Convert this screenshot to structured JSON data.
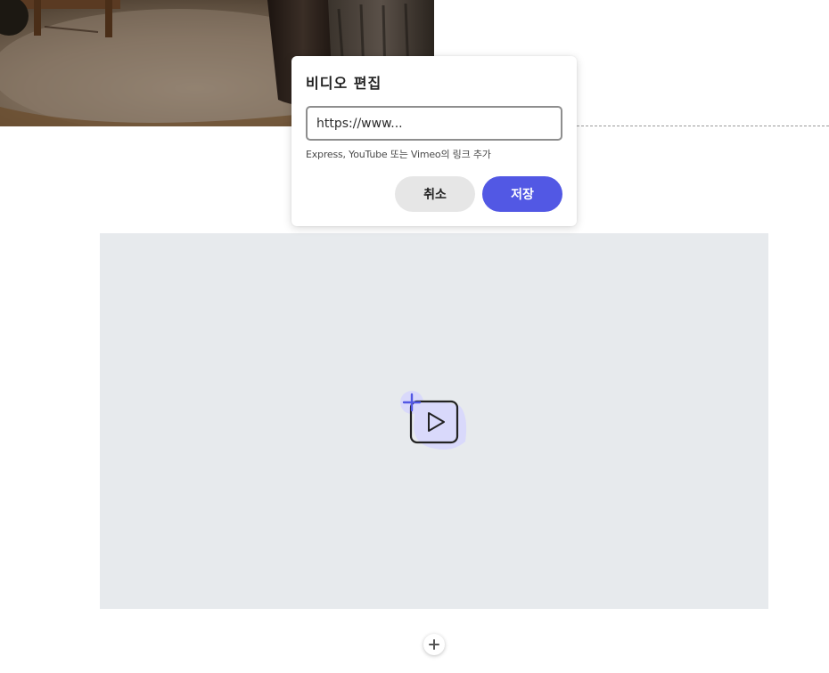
{
  "dialog": {
    "title": "비디오 편집",
    "url_placeholder": "https://www...",
    "helper_text": "Express, YouTube 또는 Vimeo의 링크 추가",
    "cancel_label": "취소",
    "save_label": "저장"
  },
  "icons": {
    "video_add": "video-add-icon",
    "add_block": "plus-icon"
  },
  "colors": {
    "accent": "#5258e4",
    "placeholder_bg": "#e7eaed",
    "icon_highlight": "#d9d9fb"
  }
}
